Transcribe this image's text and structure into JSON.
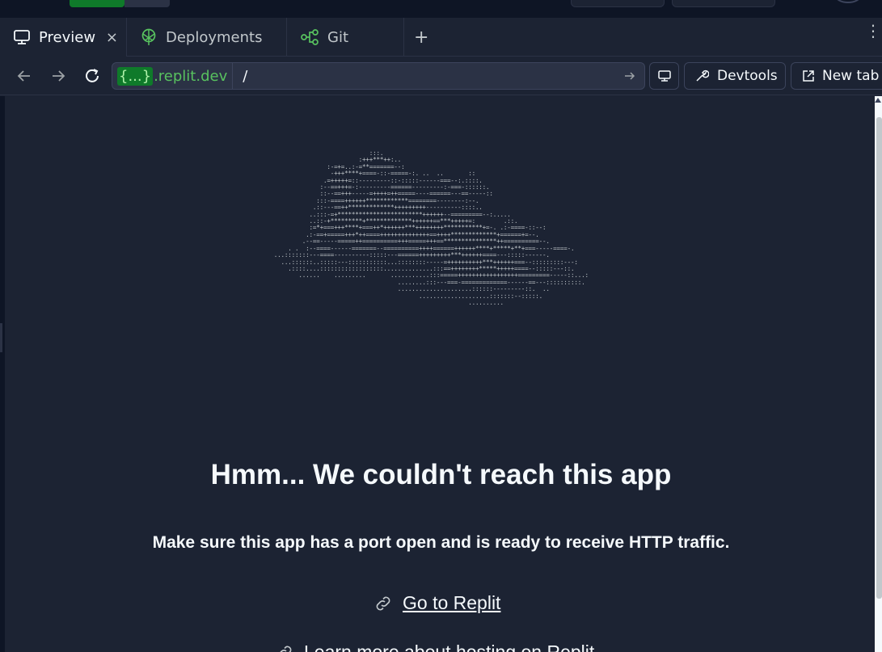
{
  "tabs": [
    {
      "label": "Preview",
      "icon": "monitor-icon",
      "active": true,
      "close": "×"
    },
    {
      "label": "Deployments",
      "icon": "deployments-icon",
      "active": false
    },
    {
      "label": "Git",
      "icon": "git-branch-icon",
      "active": false
    }
  ],
  "tabbar": {
    "add": "+",
    "more": "⋮"
  },
  "address": {
    "brace": "{...}",
    "host": ".replit.dev",
    "path": "/"
  },
  "toolbar": {
    "devtools_label": "Devtools",
    "newtab_label": "New tab"
  },
  "page": {
    "ascii_art": "                             :::.\n                          :+++***++:..\n                 :-=+=..:-=**=======--:\n                  -+++****+====-::-=====-:. ..  ..       ::\n                .=+++++=::---------::-:::::------===--:.::::.\n               :--==+++=-:---------======---------:-===-::::::.\n               ::--==+++-----=++++=++=====----======---==-----::\n              :::-====++++++************========--------:--.\n             .::---==++*************+++++++++----------::::..\n            ..:::-=+************************++++++--=========--:.....\n            ..::-+*********+*************++++++==***+++++=:        .::.\n            :=*+===+++****+===++*++++++***++++++++***********+=-. .:-====-::--:\n           .:-==+=====+++*++====++++++++++++++==++++*************+======+=--.\n          .--==-----=====++==========+++=====+++==***************++==========--.\n      . .  :--====------=======--==========++++======++++++****+*****+**+===-----====-.\n  ...:::::::---====----------:::::---======+++++++++***++++++====---:::::------.\n    ...::::::..:::::---:::::::::::...::::::::-----=++++++++++***++++++===--:::::::::---:\n      .::::....::::::::::::::::::..............:::==++++++++*****+++++====--:::::---::.\n         ......    .........       ...........:::=====+++++++++++++++++=========-----::...:\n                                     ........:::---===-=============------==---::::::::::.\n                                     .....................::::::---------::.  ..\n                                           ....................:::::::--:::::.\n                                                         ..........",
    "title": "Hmm... We couldn't reach this app",
    "subtitle": "Make sure this app has a port open and is ready to receive HTTP traffic.",
    "go_link": "Go to Replit",
    "learn_link": "Learn more about hosting on Replit"
  },
  "colors": {
    "background": "#1c2333",
    "accent_green": "#58c25f",
    "run_green": "#0f7a2a"
  }
}
